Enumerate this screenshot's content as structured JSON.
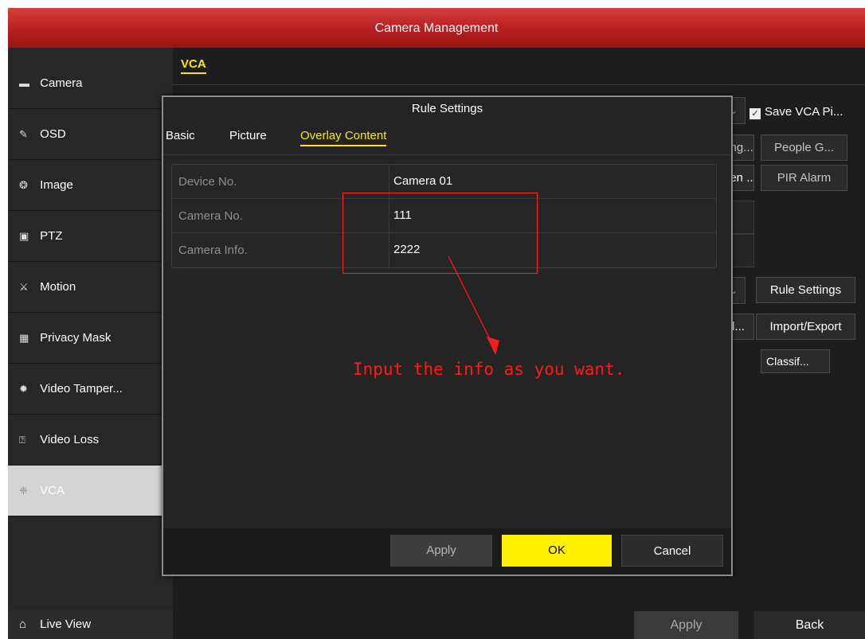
{
  "window": {
    "title": "Camera Management"
  },
  "sidebar": {
    "items": [
      {
        "label": "Camera",
        "icon": "camera-icon",
        "glyph": "▬"
      },
      {
        "label": "OSD",
        "icon": "osd-pen-icon",
        "glyph": "✎"
      },
      {
        "label": "Image",
        "icon": "image-icon",
        "glyph": "❂"
      },
      {
        "label": "PTZ",
        "icon": "ptz-icon",
        "glyph": "▣"
      },
      {
        "label": "Motion",
        "icon": "motion-icon",
        "glyph": "⚔"
      },
      {
        "label": "Privacy Mask",
        "icon": "privacy-mask-icon",
        "glyph": "▦"
      },
      {
        "label": "Video Tamper...",
        "icon": "video-tamper-icon",
        "glyph": "✹"
      },
      {
        "label": "Video Loss",
        "icon": "video-loss-icon",
        "glyph": "⍰"
      },
      {
        "label": "VCA",
        "icon": "vca-icon",
        "glyph": "❈"
      }
    ],
    "live_view": {
      "label": "Live View",
      "icon": "home-icon",
      "glyph": "⌂"
    }
  },
  "main": {
    "tab": "VCA",
    "save_vca_label": "Save VCA Pi...",
    "buttons": {
      "ring": "ring...",
      "people": "People G...",
      "hidden": "den ...",
      "pir": "PIR Alarm",
      "rule_settings": "Rule Settings",
      "list_trunc": "l...",
      "import_export": "Import/Export"
    },
    "column_classif": "Classif...",
    "footer": {
      "apply": "Apply",
      "back": "Back"
    }
  },
  "modal": {
    "title": "Rule Settings",
    "tabs": [
      "Basic",
      "Picture",
      "Overlay Content"
    ],
    "active_tab": "Overlay Content",
    "rows": [
      {
        "label": "Device No.",
        "value": "Camera 01"
      },
      {
        "label": "Camera No.",
        "value": "111"
      },
      {
        "label": "Camera Info.",
        "value": "2222"
      }
    ],
    "buttons": {
      "apply": "Apply",
      "ok": "OK",
      "cancel": "Cancel"
    }
  },
  "annotation": {
    "text": "Input the info as you want.",
    "color": "#ff1a1a"
  },
  "colors": {
    "title_bar": "#c42a2a",
    "accent": "#ffe500",
    "ok_button": "#fff100"
  }
}
